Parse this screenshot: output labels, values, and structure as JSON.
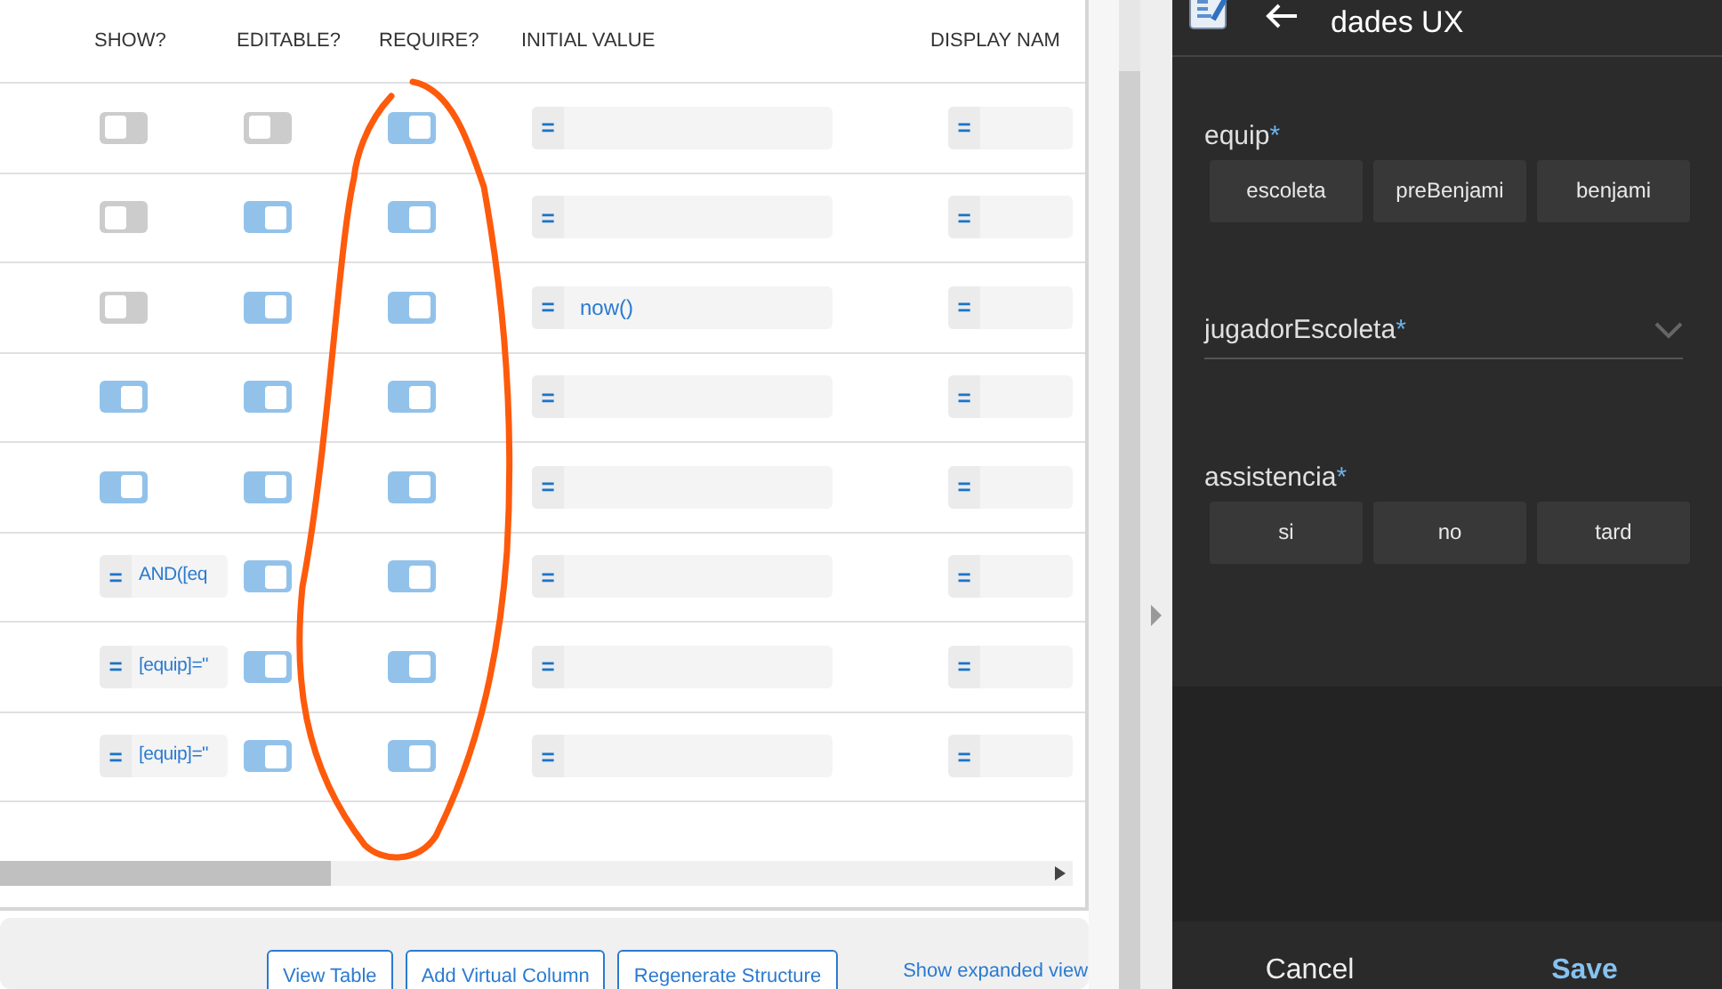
{
  "table": {
    "columns": [
      "SHOW?",
      "EDITABLE?",
      "REQUIRE?",
      "INITIAL VALUE",
      "DISPLAY NAM"
    ],
    "rows": [
      {
        "show": {
          "kind": "toggle",
          "on": false
        },
        "editable": false,
        "require": true,
        "initial_value": "",
        "display_name": ""
      },
      {
        "show": {
          "kind": "toggle",
          "on": false
        },
        "editable": true,
        "require": true,
        "initial_value": "",
        "display_name": ""
      },
      {
        "show": {
          "kind": "toggle",
          "on": false
        },
        "editable": true,
        "require": true,
        "initial_value": "now()",
        "display_name": ""
      },
      {
        "show": {
          "kind": "toggle",
          "on": true
        },
        "editable": true,
        "require": true,
        "initial_value": "",
        "display_name": ""
      },
      {
        "show": {
          "kind": "toggle",
          "on": true
        },
        "editable": true,
        "require": true,
        "initial_value": "",
        "display_name": ""
      },
      {
        "show": {
          "kind": "formula",
          "value": "AND([eq"
        },
        "editable": true,
        "require": true,
        "initial_value": "",
        "display_name": ""
      },
      {
        "show": {
          "kind": "formula",
          "value": "[equip]=\""
        },
        "editable": true,
        "require": true,
        "initial_value": "",
        "display_name": ""
      },
      {
        "show": {
          "kind": "formula",
          "value": "[equip]=\""
        },
        "editable": true,
        "require": true,
        "initial_value": "",
        "display_name": ""
      }
    ]
  },
  "formula_sign": "=",
  "bottom_bar": {
    "buttons": [
      "View Table",
      "Add Virtual Column",
      "Regenerate Structure"
    ],
    "link": "Show expanded view"
  },
  "form": {
    "title": "dades UX",
    "fields": [
      {
        "kind": "buttons",
        "label": "equip",
        "required_mark": "*",
        "options": [
          "escoleta",
          "preBenjami",
          "benjami"
        ]
      },
      {
        "kind": "dropdown",
        "label": "jugadorEscoleta",
        "required_mark": "*"
      },
      {
        "kind": "buttons",
        "label": "assistencia",
        "required_mark": "*",
        "options": [
          "si",
          "no",
          "tard"
        ]
      }
    ],
    "actions": [
      "Cancel",
      "Save"
    ]
  }
}
